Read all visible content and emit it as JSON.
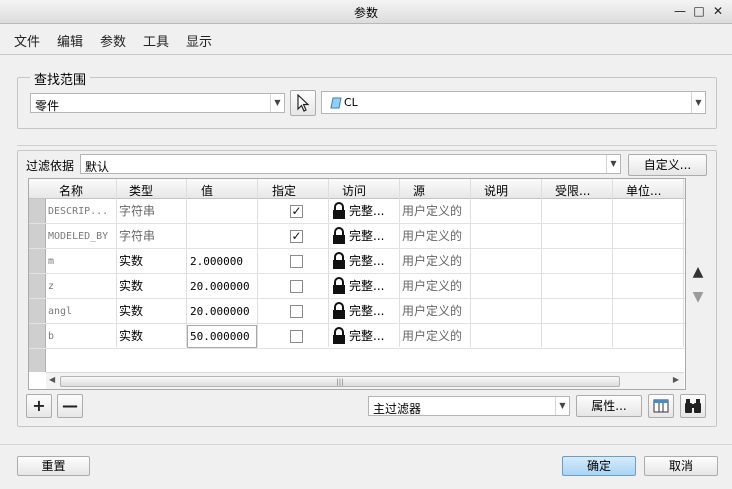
{
  "window": {
    "title": "参数"
  },
  "menu": [
    "文件",
    "编辑",
    "参数",
    "工具",
    "显示"
  ],
  "search_scope": {
    "label": "查找范围",
    "type_value": "零件",
    "object_value": "CL"
  },
  "filter": {
    "label": "过滤依据",
    "value": "默认",
    "custom_button": "自定义..."
  },
  "table": {
    "columns": [
      "名称",
      "类型",
      "值",
      "指定",
      "访问",
      "源",
      "说明",
      "受限...",
      "单位..."
    ],
    "rows": [
      {
        "name": "DESCRIP...",
        "type": "字符串",
        "value": "",
        "designated": true,
        "access": "完整...",
        "source": "用户定义的"
      },
      {
        "name": "MODELED_BY",
        "type": "字符串",
        "value": "",
        "designated": true,
        "access": "完整...",
        "source": "用户定义的"
      },
      {
        "name": "m",
        "type": "实数",
        "value": "2.000000",
        "designated": false,
        "access": "完整...",
        "source": "用户定义的"
      },
      {
        "name": "z",
        "type": "实数",
        "value": "20.000000",
        "designated": false,
        "access": "完整...",
        "source": "用户定义的"
      },
      {
        "name": "angl",
        "type": "实数",
        "value": "20.000000",
        "designated": false,
        "access": "完整...",
        "source": "用户定义的"
      },
      {
        "name": "b",
        "type": "实数",
        "value": "50.000000",
        "designated": false,
        "access": "完整...",
        "source": "用户定义的"
      }
    ]
  },
  "bottom": {
    "main_filter": "主过滤器",
    "properties_button": "属性..."
  },
  "footer": {
    "reset": "重置",
    "ok": "确定",
    "cancel": "取消"
  },
  "icons": {
    "minimize": "minimize-icon",
    "maximize": "maximize-icon",
    "close": "close-icon",
    "add": "plus-icon",
    "remove": "minus-icon",
    "select": "cursor-arrow-icon",
    "part": "part-icon",
    "lock": "lock-icon",
    "up": "arrow-up-icon",
    "down": "arrow-down-icon",
    "columns": "table-columns-icon",
    "find": "binoculars-icon"
  },
  "colors": {
    "primary_button": "#a9d4f5",
    "background": "#f0f0f0"
  }
}
